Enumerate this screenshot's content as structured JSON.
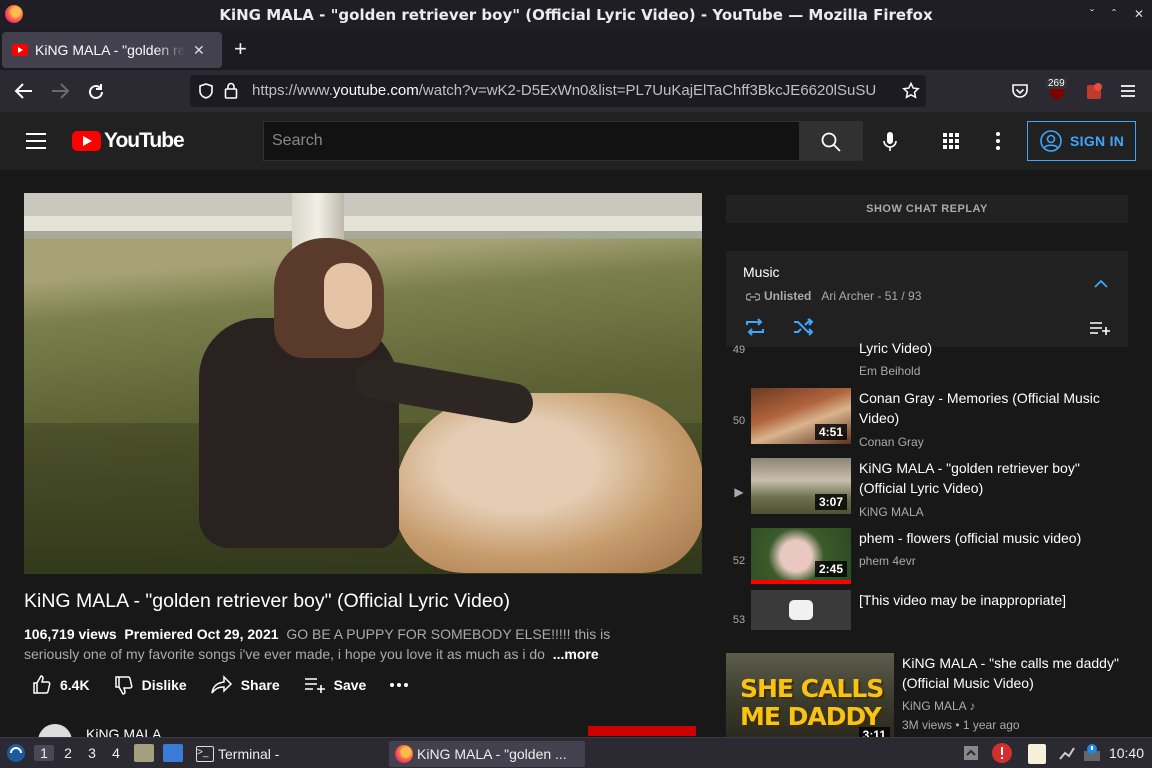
{
  "window": {
    "title": "KiNG MALA - \"golden retriever boy\" (Official Lyric Video) - YouTube — Mozilla Firefox",
    "controls": [
      "ˇ",
      "ˆ",
      "✕"
    ]
  },
  "tab": {
    "label": "KiNG MALA - \"golden retriever boy\" (Official Lyric Video) - YouTube",
    "close": "✕",
    "new_tab": "+"
  },
  "nav": {
    "url_prefix": "https://www.",
    "url_domain": "youtube.com",
    "url_rest": "/watch?v=wK2-D5ExWn0&list=PL7UuKajElTaChff3BkcJE6620lSuSU",
    "badge_count": "269"
  },
  "youtube": {
    "logo_text": "YouTube",
    "search_placeholder": "Search",
    "sign_in": "SIGN IN"
  },
  "video": {
    "title": "KiNG MALA - \"golden retriever boy\" (Official Lyric Video)",
    "views": "106,719 views",
    "premiered": "Premiered Oct 29, 2021",
    "description": "GO BE A PUPPY FOR SOMEBODY ELSE!!!!! this is seriously one of my favorite songs i've ever made, i hope you love it as much as i do",
    "more": "...more",
    "likes": "6.4K",
    "dislike": "Dislike",
    "share": "Share",
    "save": "Save",
    "channel": "KiNG MALA"
  },
  "sidebar": {
    "chat_replay": "SHOW CHAT REPLAY",
    "playlist": {
      "title": "Music",
      "visibility": "Unlisted",
      "owner_pos": "Ari Archer - 51 / 93"
    },
    "items": [
      {
        "num": "49",
        "title": "Lyric Video)",
        "channel": "Em Beihold",
        "duration": ""
      },
      {
        "num": "50",
        "title": "Conan Gray - Memories (Official Music Video)",
        "channel": "Conan Gray",
        "duration": "4:51"
      },
      {
        "num": "▶",
        "title": "KiNG MALA - \"golden retriever boy\" (Official Lyric Video)",
        "channel": "KiNG MALA",
        "duration": "3:07"
      },
      {
        "num": "52",
        "title": "phem - flowers (official music video)",
        "channel": "phem 4evr",
        "duration": "2:45"
      },
      {
        "num": "53",
        "title": "[This video may be inappropriate]",
        "channel": "",
        "duration": ""
      }
    ],
    "recommended": {
      "thumb_text_1": "SHE CALLS",
      "thumb_text_2": "ME DADDY",
      "duration": "3:11",
      "title": "KiNG MALA - \"she calls me daddy\" (Official Music Video)",
      "channel": "KiNG MALA",
      "meta": "3M views • 1 year ago"
    }
  },
  "taskbar": {
    "workspaces": [
      "1",
      "2",
      "3",
      "4"
    ],
    "terminal": "Terminal -",
    "firefox": "KiNG MALA - \"golden ...",
    "clock": "10:40"
  },
  "colors": {
    "accent_blue": "#3ea6ff",
    "youtube_red": "#ff0000",
    "bg_dark": "#181818"
  }
}
